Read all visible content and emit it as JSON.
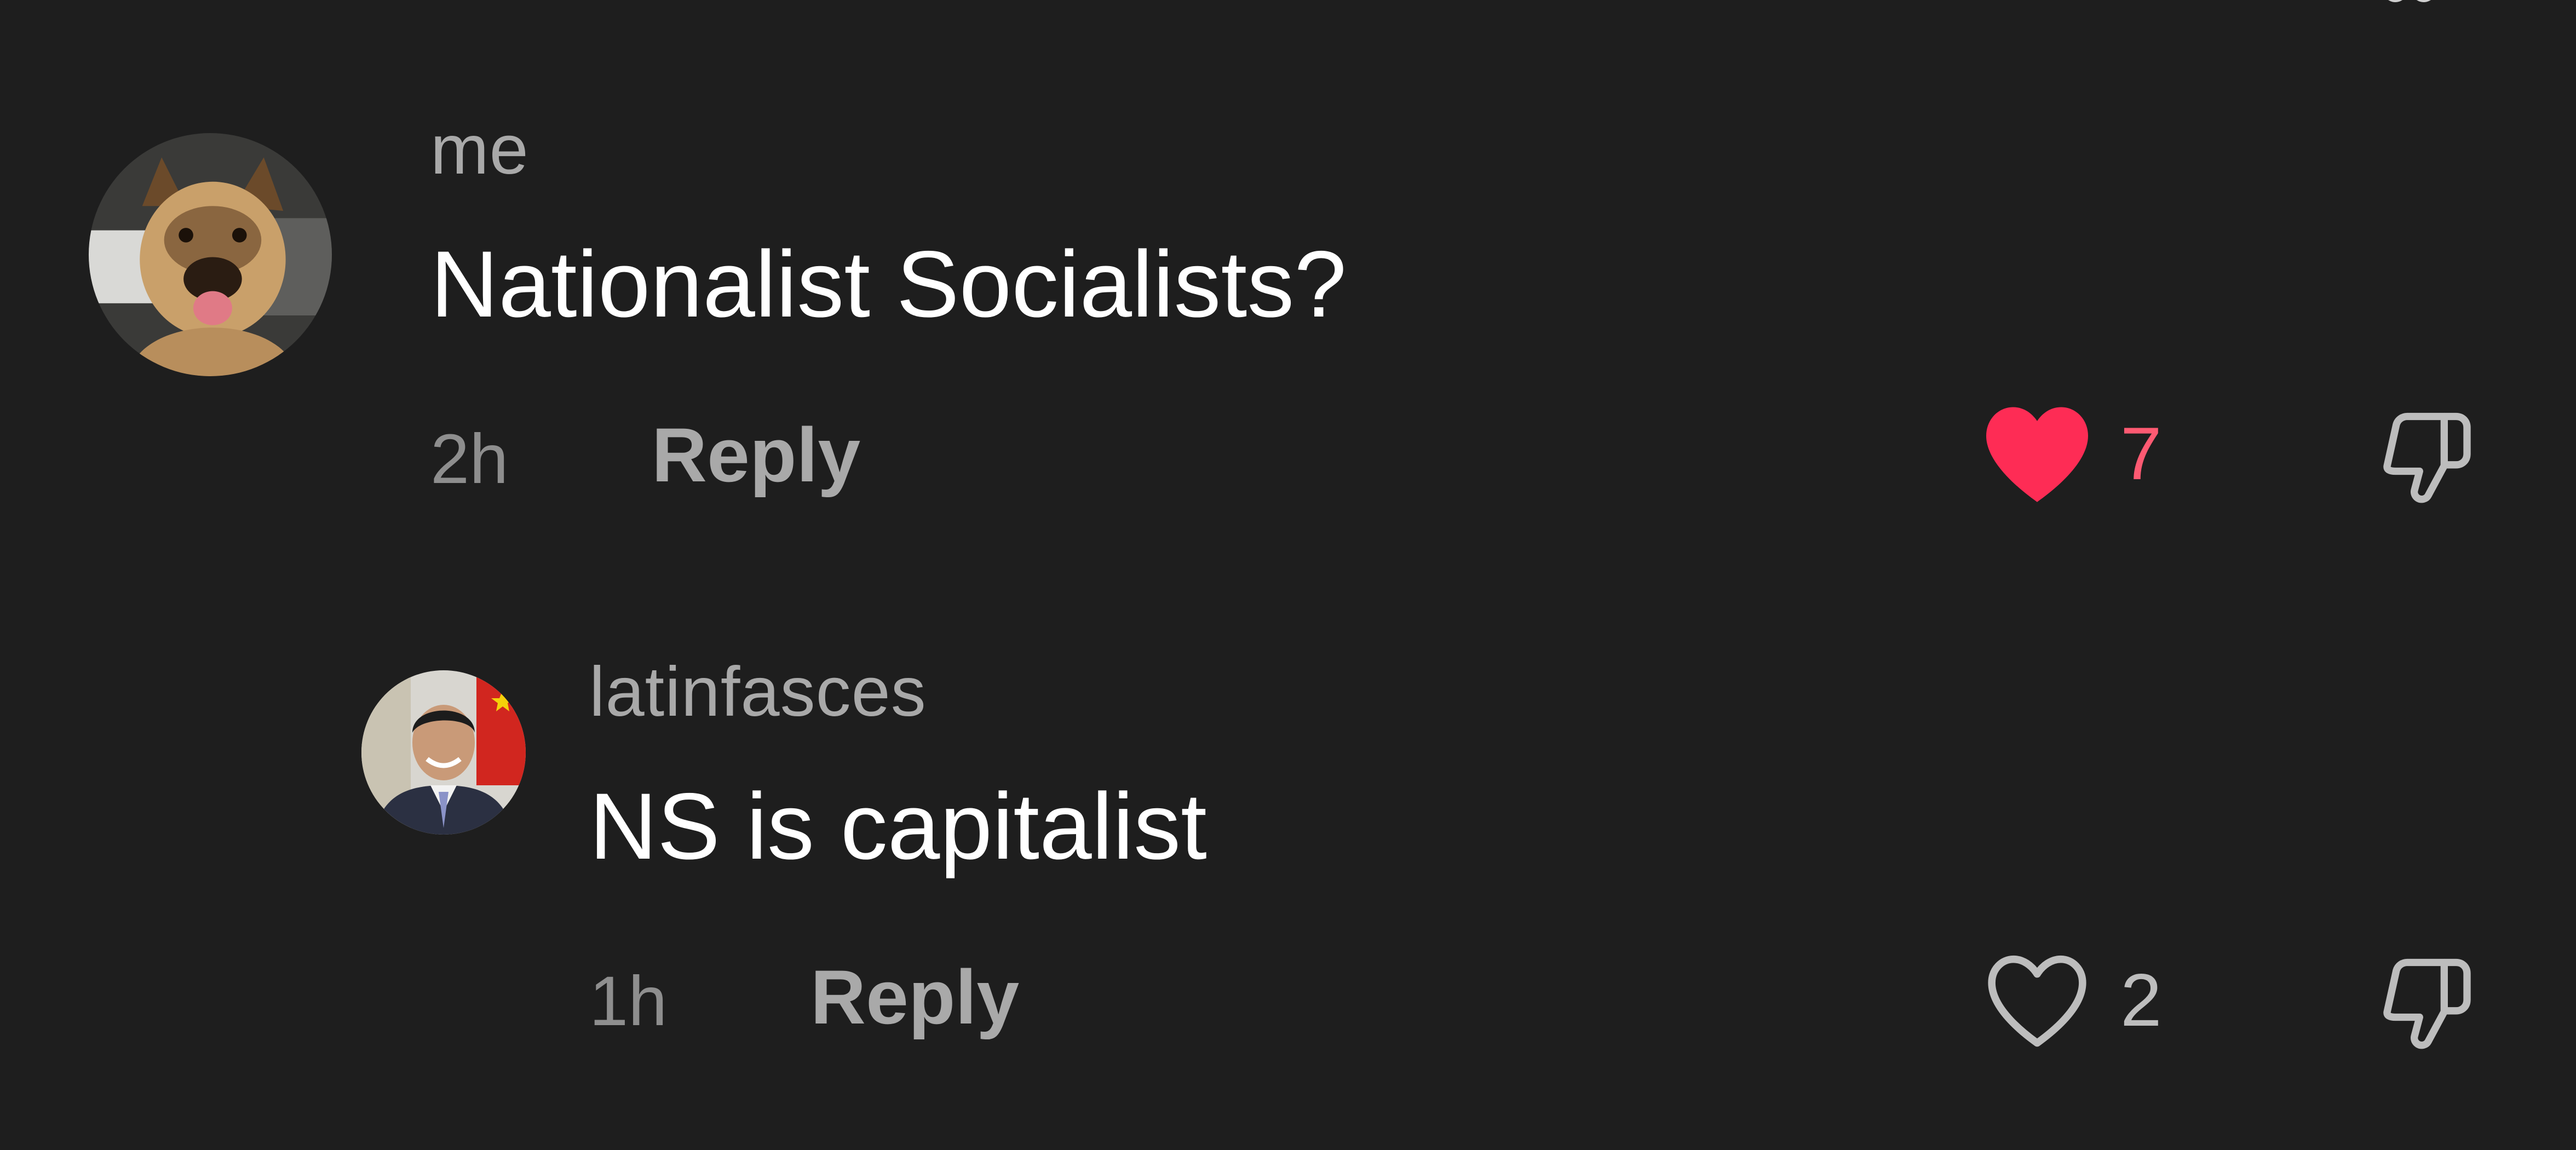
{
  "colors": {
    "background": "#1e1e1e",
    "liked_heart": "#fe2c55",
    "liked_count": "#fe5a72",
    "muted_text": "#a9a9a9",
    "icon_stroke": "#bdbdbd"
  },
  "comments": [
    {
      "username": "me",
      "text": "Nationalist Socialists?",
      "time": "2h",
      "reply_label": "Reply",
      "like_count": "7",
      "liked": true,
      "avatar_icon": "dog-avatar",
      "like_icon": "heart-filled-icon",
      "dislike_icon": "thumbs-down-icon"
    },
    {
      "username": "latinfasces",
      "text": "NS is capitalist",
      "time": "1h",
      "reply_label": "Reply",
      "like_count": "2",
      "liked": false,
      "avatar_icon": "person-avatar",
      "like_icon": "heart-outline-icon",
      "dislike_icon": "thumbs-down-icon"
    }
  ]
}
